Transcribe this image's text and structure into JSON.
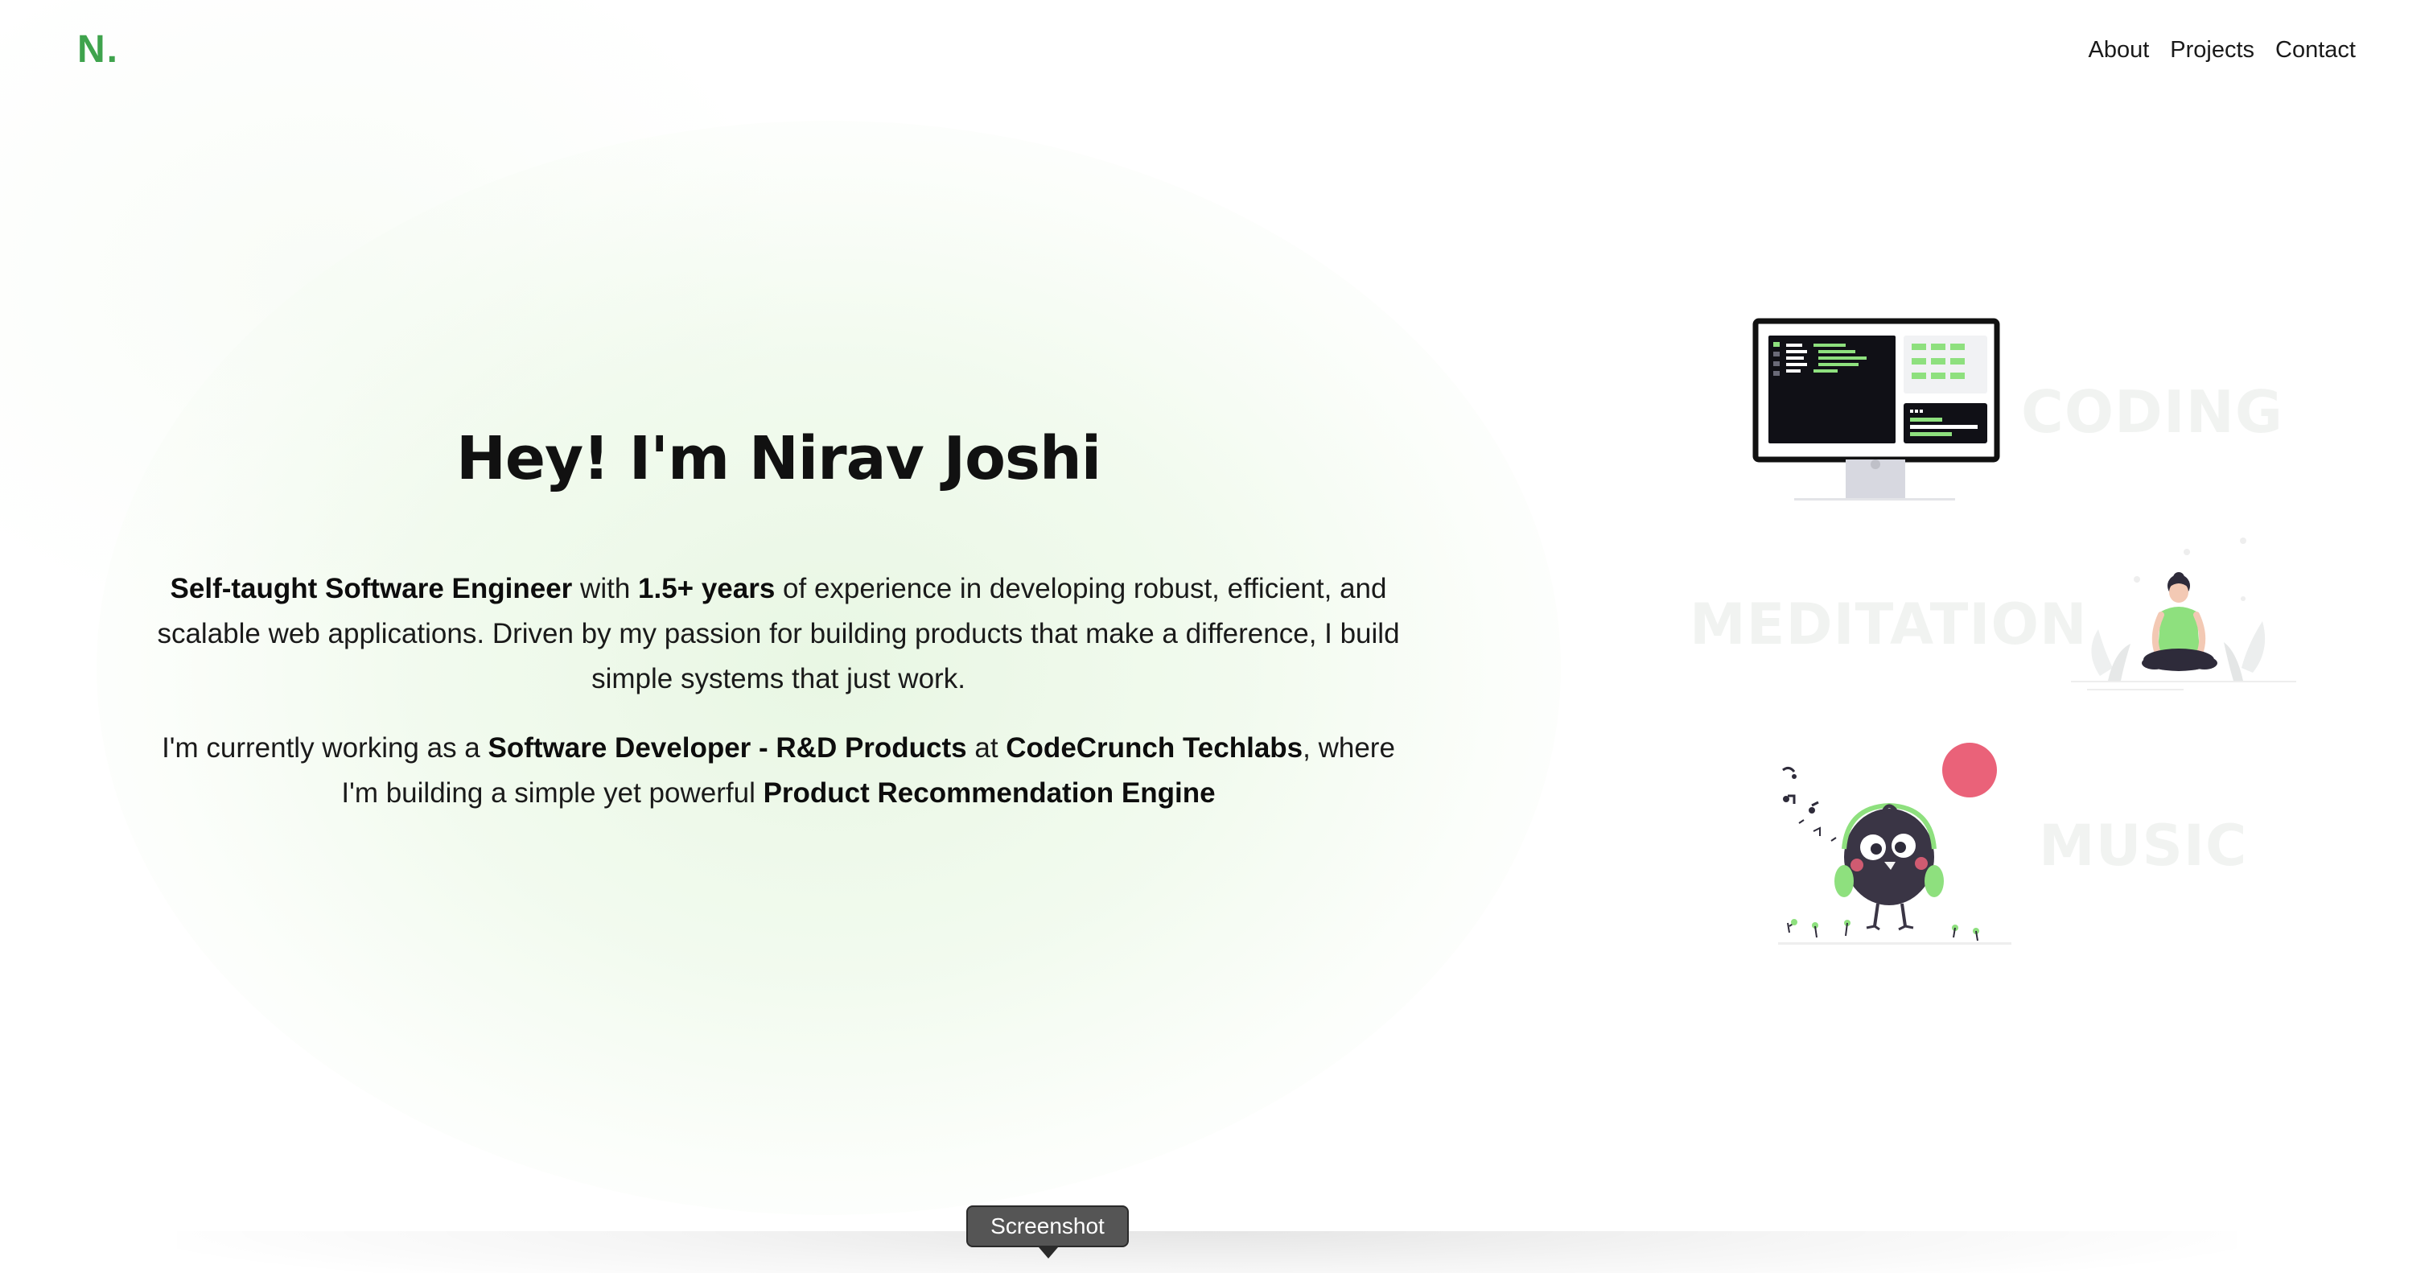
{
  "header": {
    "logo_letter": "N",
    "logo_dot": ".",
    "nav": [
      {
        "label": "About"
      },
      {
        "label": "Projects"
      },
      {
        "label": "Contact"
      }
    ]
  },
  "hero": {
    "title": "Hey! I'm Nirav Joshi",
    "intro": {
      "role": "Self-taught Software Engineer",
      "t1": " with ",
      "years": "1.5+ years",
      "t2": " of experience in developing robust, efficient, and scalable web applications. Driven by my passion for building products that make a difference, I build simple systems that just work."
    },
    "current": {
      "t1": "I'm currently working as a ",
      "position": "Software Developer - R&D Products",
      "t2": " at ",
      "company": "CodeCrunch Techlabs",
      "t3": ", where I'm building a simple yet powerful ",
      "project": "Product Recommendation Engine"
    }
  },
  "illustrations": {
    "words": [
      "CODING",
      "MEDITATION",
      "MUSIC"
    ],
    "icons": [
      "monitor-code-icon",
      "meditating-person-icon",
      "music-bird-icon"
    ]
  },
  "tooltip": {
    "label": "Screenshot"
  },
  "colors": {
    "accent": "#3fa34d",
    "illustration_green": "#8ee07e",
    "music_circle": "#ea6279",
    "dark": "#1a1a1a"
  }
}
